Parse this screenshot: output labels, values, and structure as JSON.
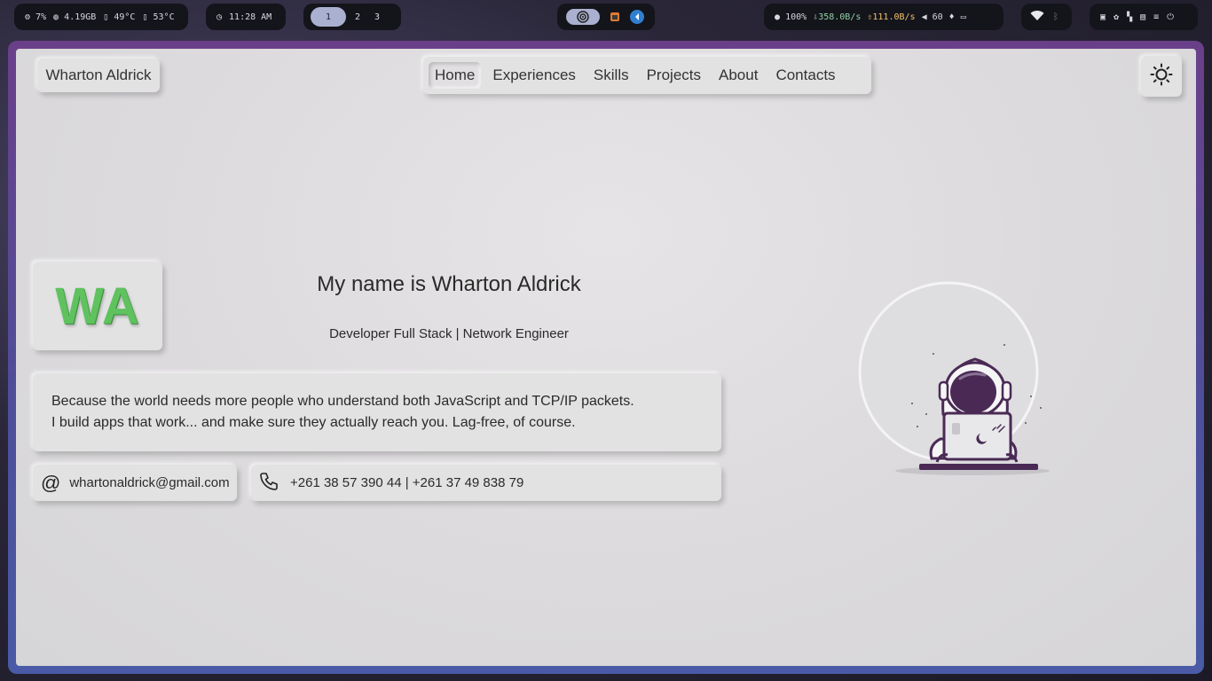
{
  "statusbar": {
    "cpu": "7%",
    "memory": "4.19GB",
    "temp1": "49°C",
    "temp2": "53°C",
    "clock": "11:28 AM",
    "workspaces": [
      "1",
      "2",
      "3"
    ],
    "battery": "100%",
    "download": "358.0B/s",
    "upload": "111.0B/s",
    "volume": "60"
  },
  "site": {
    "brand": "Wharton Aldrick",
    "nav": [
      {
        "label": "Home",
        "active": true
      },
      {
        "label": "Experiences"
      },
      {
        "label": "Skills"
      },
      {
        "label": "Projects"
      },
      {
        "label": "About"
      },
      {
        "label": "Contacts"
      }
    ],
    "logo_initials": "WA",
    "headline": "My name is Wharton Aldrick",
    "subtitle": "Developer Full Stack | Network Engineer",
    "bio_line1": "Because the world needs more people who understand both JavaScript and TCP/IP packets.",
    "bio_line2": "I build apps that work... and make sure they actually reach you. Lag-free, of course.",
    "email": "whartonaldrick@gmail.com",
    "phone": "+261 38 57 390 44 | +261 37 49 838 79"
  },
  "icons": {
    "theme_toggle": "sun-icon",
    "email": "at-icon",
    "phone": "phone-icon"
  },
  "colors": {
    "logo_green": "#5fc25f",
    "astronaut_purple": "#4a2a55",
    "workspace_active": "#aab0cf"
  }
}
